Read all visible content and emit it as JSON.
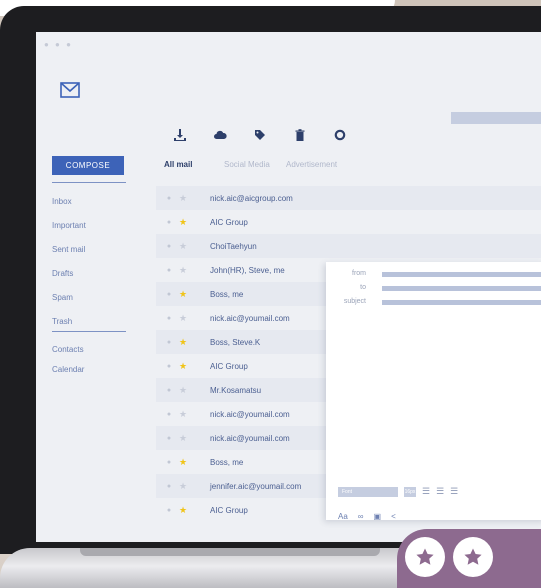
{
  "window": {
    "dots": "● ● ●"
  },
  "toolbar": {
    "icons": [
      "download-icon",
      "cloud-icon",
      "tag-icon",
      "trash-icon",
      "settings-icon"
    ]
  },
  "sidebar": {
    "compose_label": "COMPOSE",
    "items": [
      "Inbox",
      "Important",
      "Sent mail",
      "Drafts",
      "Spam",
      "Trash"
    ],
    "extra": [
      "Contacts",
      "Calendar"
    ]
  },
  "tabs": [
    "All mail",
    "Social Media",
    "Advertisement"
  ],
  "mails": [
    {
      "sender": "nick.aic@aicgroup.com",
      "starred": false
    },
    {
      "sender": "AIC Group",
      "starred": true
    },
    {
      "sender": "ChoiTaehyun",
      "starred": false
    },
    {
      "sender": "John(HR), Steve, me",
      "starred": false
    },
    {
      "sender": "Boss, me",
      "starred": true
    },
    {
      "sender": "nick.aic@youmail.com",
      "starred": false
    },
    {
      "sender": "Boss, Steve.K",
      "starred": true
    },
    {
      "sender": "AIC Group",
      "starred": true
    },
    {
      "sender": "Mr.Kosamatsu",
      "starred": false
    },
    {
      "sender": "nick.aic@youmail.com",
      "starred": false
    },
    {
      "sender": "nick.aic@youmail.com",
      "starred": false
    },
    {
      "sender": "Boss, me",
      "starred": true
    },
    {
      "sender": "jennifer.aic@youmail.com",
      "starred": false
    },
    {
      "sender": "AIC Group",
      "starred": true
    }
  ],
  "compose": {
    "from_label": "from",
    "to_label": "to",
    "subject_label": "subject",
    "font_value": "Font",
    "size_value": "16px",
    "bottom_text": "Aa"
  },
  "colors": {
    "accent": "#3d63b8",
    "star": "#f0c419",
    "badge": "#8d6a8f"
  }
}
